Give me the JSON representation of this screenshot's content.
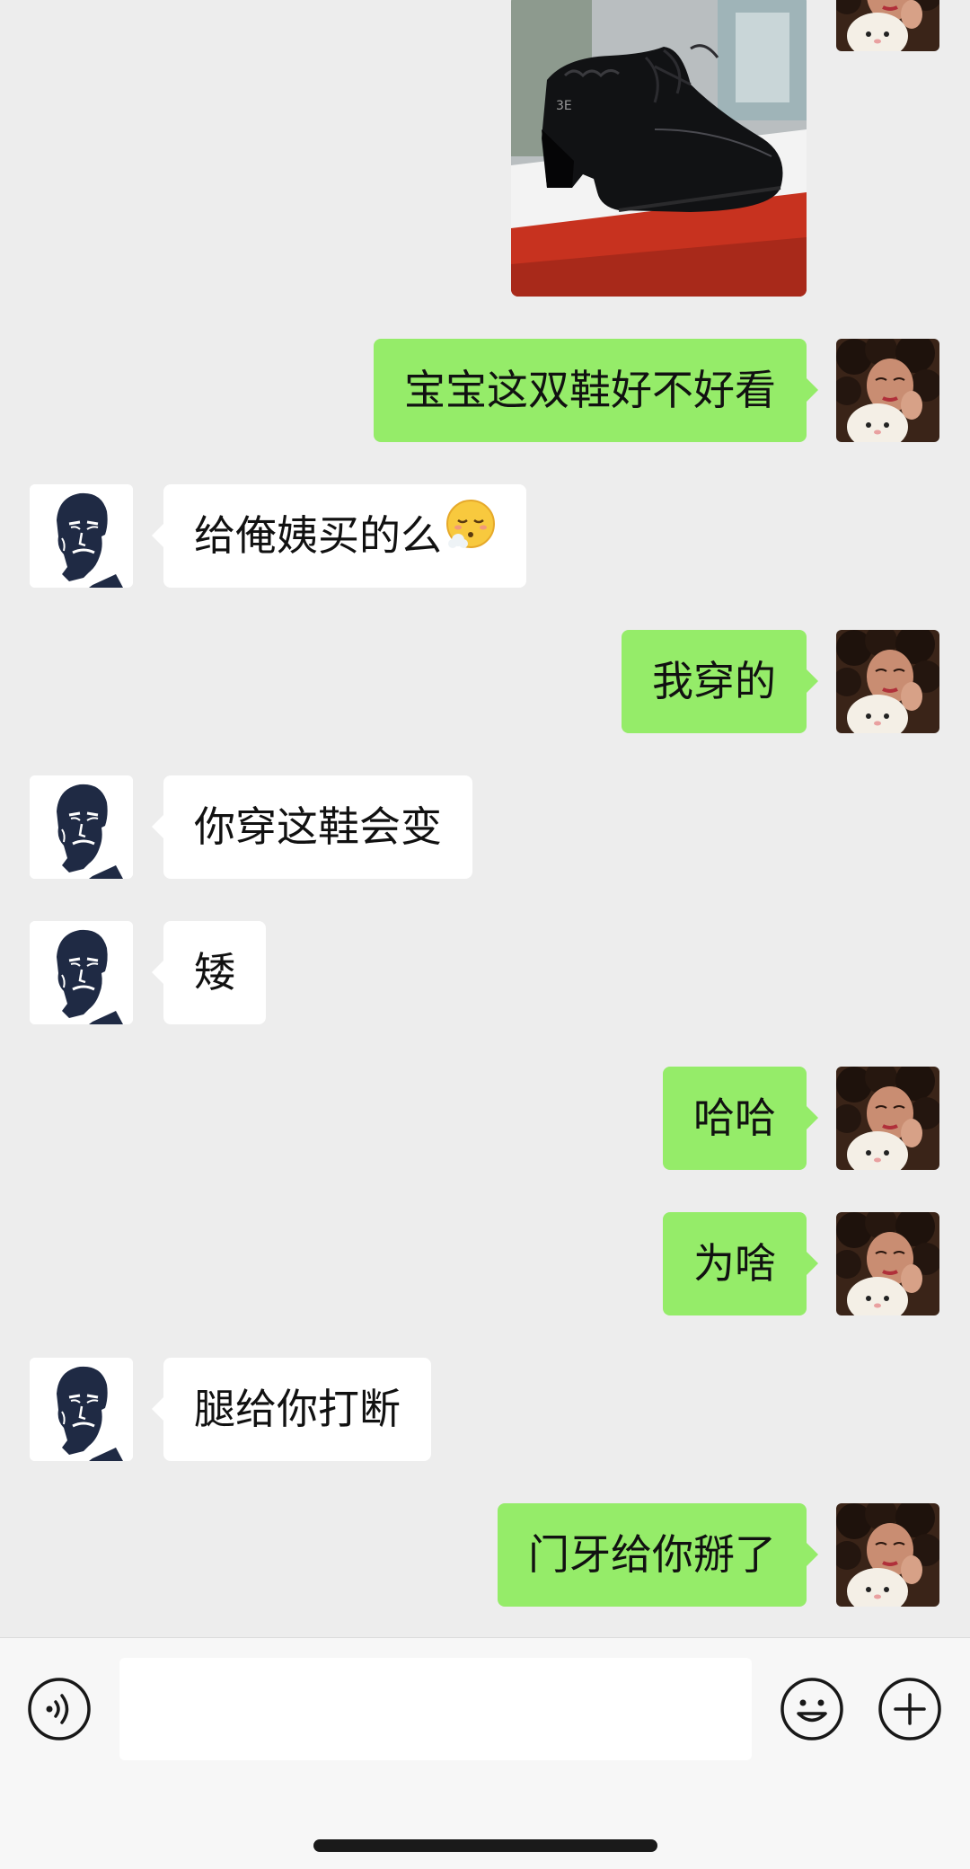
{
  "messages": [
    {
      "id": 1,
      "sender": "me",
      "type": "image",
      "image": "black-low-heel-lace-up-shoe-photo"
    },
    {
      "id": 2,
      "sender": "me",
      "type": "text",
      "text": "宝宝这双鞋好不好看"
    },
    {
      "id": 3,
      "sender": "them",
      "type": "text",
      "text": "给俺姨买的么",
      "emoji": "face-exhaling-emoji"
    },
    {
      "id": 4,
      "sender": "me",
      "type": "text",
      "text": "我穿的"
    },
    {
      "id": 5,
      "sender": "them",
      "type": "text",
      "text": "你穿这鞋会变"
    },
    {
      "id": 6,
      "sender": "them",
      "type": "text",
      "text": "矮"
    },
    {
      "id": 7,
      "sender": "me",
      "type": "text",
      "text": "哈哈"
    },
    {
      "id": 8,
      "sender": "me",
      "type": "text",
      "text": "为啥"
    },
    {
      "id": 9,
      "sender": "them",
      "type": "text",
      "text": "腿给你打断"
    },
    {
      "id": 10,
      "sender": "me",
      "type": "text",
      "text": "门牙给你掰了"
    }
  ],
  "input": {
    "value": "",
    "placeholder": ""
  },
  "icons": {
    "voice": "voice-input-icon",
    "emoji": "smiley-icon",
    "more": "plus-icon"
  },
  "colors": {
    "background": "#ededed",
    "my_bubble": "#95ec69",
    "their_bubble": "#ffffff",
    "input_bar": "#f7f7f7"
  }
}
